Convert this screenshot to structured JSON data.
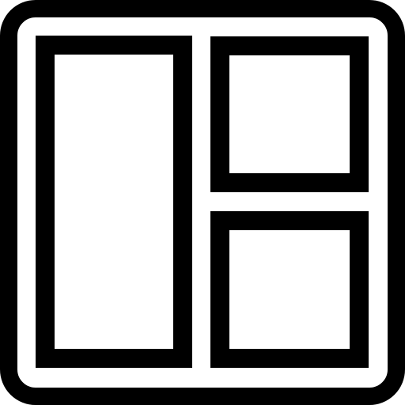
{
  "icon": {
    "name": "layout-icon",
    "stroke_color": "#000000",
    "fill_color": "#ffffff",
    "panels": [
      "left-column",
      "top-right",
      "bottom-right"
    ]
  }
}
